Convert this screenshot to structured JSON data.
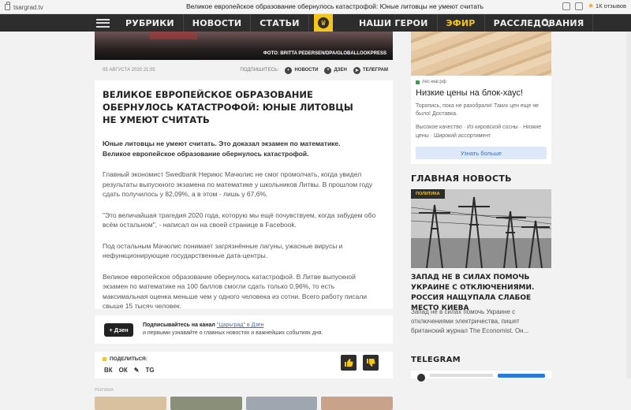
{
  "browser": {
    "url": "tsargrad.tv",
    "tab_title": "Великое европейское образование обернулось катастрофой: Юные литовцы не умеют считать",
    "reviews": "1К отзывов"
  },
  "nav": {
    "left": [
      "РУБРИКИ",
      "НОВОСТИ",
      "СТАТЬИ"
    ],
    "right": [
      "НАШИ ГЕРОИ",
      "ЭФИР",
      "РАССЛЕДОВАНИЯ"
    ]
  },
  "article": {
    "photo_caption": "ФОТО: BRITTA PEDERSEN/DPA/GLOBALLOOKPRESS",
    "date": "05 АВГУСТА 2020 21:05",
    "subscribe_label": "ПОДПИШИТЕСЬ:",
    "subscribe_news": "НОВОСТИ",
    "subscribe_dzen": "ДЗЕН",
    "subscribe_tg": "ТЕЛЕГРАМ",
    "title": "ВЕЛИКОЕ ЕВРОПЕЙСКОЕ ОБРАЗОВАНИЕ ОБЕРНУЛОСЬ КАТАСТРОФОЙ: ЮНЫЕ ЛИТОВЦЫ НЕ УМЕЮТ СЧИТАТЬ",
    "lead": "Юные литовцы не умеют считать. Это доказал экзамен по математике. Великое европейское образование обернулось катастрофой.",
    "paragraphs": [
      "Главный экономист Swedbank Нериюс Мачюлис не смог промолчать, когда увидел результаты выпускного экзамена по математике у школьников Литвы. В прошлом году сдать получилось у 82,09%, а в этом - лишь у 67,6%.",
      "\"Это величайшая трагедия 2020 года, которую мы ещё почувствуем, когда забудем обо всём остальном\", - написал он на своей странице в Facebook.",
      "Под остальным Мачюлис понимает загрязнённые лагуны, ужасные вирусы и нефункционирующие государственные дата-центры.",
      "Великое европейское образование обернулось катастрофой. В Литве выпускной экзамен по математике на 100 баллов смогли сдать только 0,96%, то есть максимальная оценка меньше чем у одного человека из сотни. Всего работу писали свыше 15 тысяч человек."
    ],
    "dzen_button": "+ Дзен",
    "sub_line1_pre": "Подписывайтесь на канал",
    "sub_line1_link": "\"Царьград\" в Дзен",
    "sub_line2": "и первыми узнавайте о главных новостях и важнейших событиях дня.",
    "share_label": "ПОДЕЛИТЬСЯ:",
    "share_icons": [
      "ВК",
      "ОК",
      "✎",
      "TG"
    ],
    "ad_label": "РЕКЛАМА"
  },
  "sidebar": {
    "ad": {
      "site": "лес-маг.рф",
      "title": "Низкие цены на блок-хаус!",
      "text": "Торопись, пока не разобрали! Таких цен еще не было! Доставка.",
      "tags": "Высокое качество · Из кировской сосны · Низкие цены · Широкий ассортимент",
      "button": "Узнать больше"
    },
    "main_news_heading": "ГЛАВНАЯ НОВОСТЬ",
    "main_news_tag": "ПОЛИТИКА",
    "main_news_title": "ЗАПАД НЕ В СИЛАХ ПОМОЧЬ УКРАИНЕ С ОТКЛЮЧЕНИЯМИ. РОССИЯ НАЩУПАЛА СЛАБОЕ МЕСТО КИЕВА",
    "main_news_text": "Запад не в силах помочь Украине с отключениями электричества, пишет британский журнал The Economist. Он...",
    "telegram_heading": "TELEGRAM"
  }
}
